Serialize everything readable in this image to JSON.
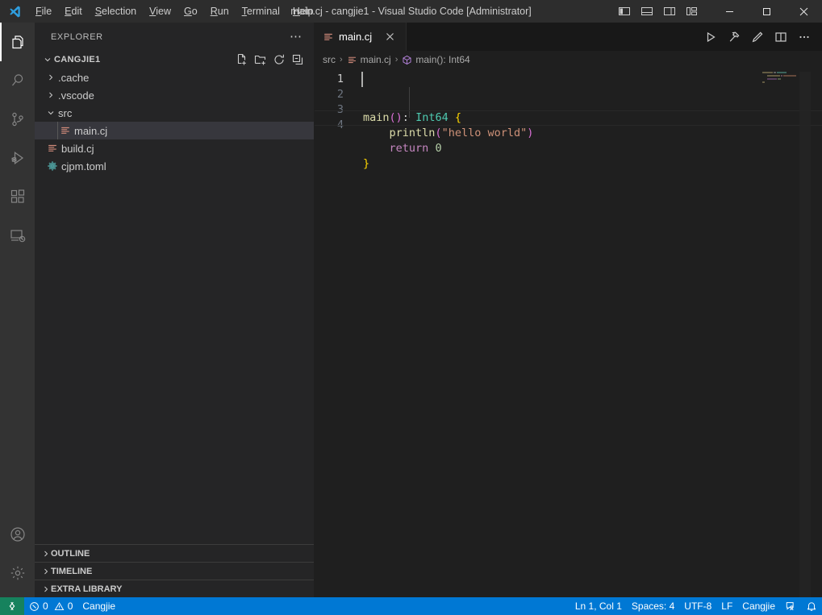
{
  "window": {
    "title": "main.cj - cangjie1 - Visual Studio Code [Administrator]",
    "menu": [
      {
        "label": "File",
        "accesskey": "F"
      },
      {
        "label": "Edit",
        "accesskey": "E"
      },
      {
        "label": "Selection",
        "accesskey": "S"
      },
      {
        "label": "View",
        "accesskey": "V"
      },
      {
        "label": "Go",
        "accesskey": "G"
      },
      {
        "label": "Run",
        "accesskey": "R"
      },
      {
        "label": "Terminal",
        "accesskey": "T"
      },
      {
        "label": "Help",
        "accesskey": "H"
      }
    ],
    "layout_buttons": [
      {
        "name": "toggle-primary-sidebar",
        "title": "Toggle Primary Side Bar"
      },
      {
        "name": "toggle-panel",
        "title": "Toggle Panel"
      },
      {
        "name": "toggle-secondary-sidebar",
        "title": "Toggle Secondary Side Bar"
      },
      {
        "name": "customize-layout",
        "title": "Customize Layout"
      }
    ],
    "controls": [
      {
        "name": "minimize",
        "glyph": "─"
      },
      {
        "name": "maximize",
        "glyph": "□"
      },
      {
        "name": "close",
        "glyph": "✕"
      }
    ]
  },
  "activitybar": {
    "top": [
      {
        "name": "explorer",
        "icon": "files-icon",
        "active": true
      },
      {
        "name": "search",
        "icon": "search-icon",
        "active": false
      },
      {
        "name": "source-control",
        "icon": "source-control-icon",
        "active": false
      },
      {
        "name": "run-and-debug",
        "icon": "debug-icon",
        "active": false
      },
      {
        "name": "extensions",
        "icon": "extensions-icon",
        "active": false
      },
      {
        "name": "remote-explorer",
        "icon": "remote-explorer-icon",
        "active": false
      }
    ],
    "bottom": [
      {
        "name": "accounts",
        "icon": "account-icon"
      },
      {
        "name": "manage",
        "icon": "gear-icon"
      }
    ]
  },
  "sidebar": {
    "title": "EXPLORER",
    "more_actions": "⋯",
    "folder": {
      "name": "CANGJIE1",
      "expanded": true,
      "actions": [
        {
          "name": "new-file",
          "icon": "new-file-icon"
        },
        {
          "name": "new-folder",
          "icon": "new-folder-icon"
        },
        {
          "name": "refresh-explorer",
          "icon": "refresh-icon"
        },
        {
          "name": "collapse-folders",
          "icon": "collapse-all-icon"
        }
      ]
    },
    "tree": [
      {
        "label": ".cache",
        "type": "folder",
        "expanded": false,
        "depth": 1,
        "icon": "chevron-right-icon",
        "selected": false
      },
      {
        "label": ".vscode",
        "type": "folder",
        "expanded": false,
        "depth": 1,
        "icon": "chevron-right-icon",
        "selected": false
      },
      {
        "label": "src",
        "type": "folder",
        "expanded": true,
        "depth": 1,
        "icon": "chevron-down-icon",
        "selected": false
      },
      {
        "label": "main.cj",
        "type": "file",
        "depth": 2,
        "icon": "cangjie-file-icon",
        "selected": true
      },
      {
        "label": "build.cj",
        "type": "file",
        "depth": 1,
        "icon": "cangjie-file-icon",
        "selected": false
      },
      {
        "label": "cjpm.toml",
        "type": "file",
        "depth": 1,
        "icon": "toml-file-icon",
        "selected": false
      }
    ],
    "collapsed_sections": [
      {
        "label": "OUTLINE"
      },
      {
        "label": "TIMELINE"
      },
      {
        "label": "EXTRA LIBRARY"
      }
    ]
  },
  "editor": {
    "tabs": [
      {
        "label": "main.cj",
        "icon": "cangjie-file-icon",
        "active": true,
        "close": "✕"
      }
    ],
    "actions": [
      {
        "name": "run-file",
        "icon": "play-icon"
      },
      {
        "name": "build-file",
        "icon": "hammer-icon"
      },
      {
        "name": "edit-icon",
        "icon": "pencil-icon"
      },
      {
        "name": "split-editor",
        "icon": "split-editor-icon"
      },
      {
        "name": "more-actions",
        "icon": "ellipsis-icon"
      }
    ],
    "breadcrumbs": [
      {
        "label": "src",
        "icon": null
      },
      {
        "label": "main.cj",
        "icon": "cangjie-file-icon"
      },
      {
        "label": "main(): Int64",
        "icon": "method-icon"
      }
    ],
    "separator": "›",
    "line_numbers": [
      "1",
      "2",
      "3",
      "4"
    ],
    "code_lines": [
      [
        {
          "t": "main",
          "c": "tok-fn"
        },
        {
          "t": "()",
          "c": "tok-paren"
        },
        {
          "t": ":",
          "c": "tok-plain"
        },
        {
          "t": " ",
          "c": "tok-plain"
        },
        {
          "t": "Int64",
          "c": "tok-type"
        },
        {
          "t": " ",
          "c": "tok-plain"
        },
        {
          "t": "{",
          "c": "tok-punc"
        }
      ],
      [
        {
          "t": "    ",
          "c": "tok-plain"
        },
        {
          "t": "println",
          "c": "tok-fn"
        },
        {
          "t": "(",
          "c": "tok-paren"
        },
        {
          "t": "\"hello world\"",
          "c": "tok-str"
        },
        {
          "t": ")",
          "c": "tok-paren"
        }
      ],
      [
        {
          "t": "    ",
          "c": "tok-plain"
        },
        {
          "t": "return",
          "c": "tok-kw"
        },
        {
          "t": " ",
          "c": "tok-plain"
        },
        {
          "t": "0",
          "c": "tok-num"
        }
      ],
      [
        {
          "t": "}",
          "c": "tok-punc"
        }
      ]
    ]
  },
  "statusbar": {
    "remote": {
      "icon": "remote-icon",
      "label": ""
    },
    "left": [
      {
        "name": "problems",
        "errors": "0",
        "warnings": "0",
        "error_icon": "error-circle-icon",
        "warning_icon": "warning-triangle-icon"
      },
      {
        "name": "language-status",
        "label": "Cangjie"
      }
    ],
    "right": [
      {
        "name": "editor-position",
        "label": "Ln 1, Col 1"
      },
      {
        "name": "editor-indentation",
        "label": "Spaces: 4"
      },
      {
        "name": "editor-encoding",
        "label": "UTF-8"
      },
      {
        "name": "editor-eol",
        "label": "LF"
      },
      {
        "name": "editor-language",
        "label": "Cangjie"
      },
      {
        "name": "feedback",
        "icon": "feedback-icon"
      },
      {
        "name": "notifications",
        "icon": "bell-icon"
      }
    ]
  },
  "colors": {
    "accent": "#0078d4",
    "remote_green": "#16825d",
    "titlebar_bg": "#2d2d2d",
    "activitybar_bg": "#333333",
    "sidebar_bg": "#252526",
    "editor_bg": "#1f1f1f",
    "selected_row": "#37373d"
  }
}
